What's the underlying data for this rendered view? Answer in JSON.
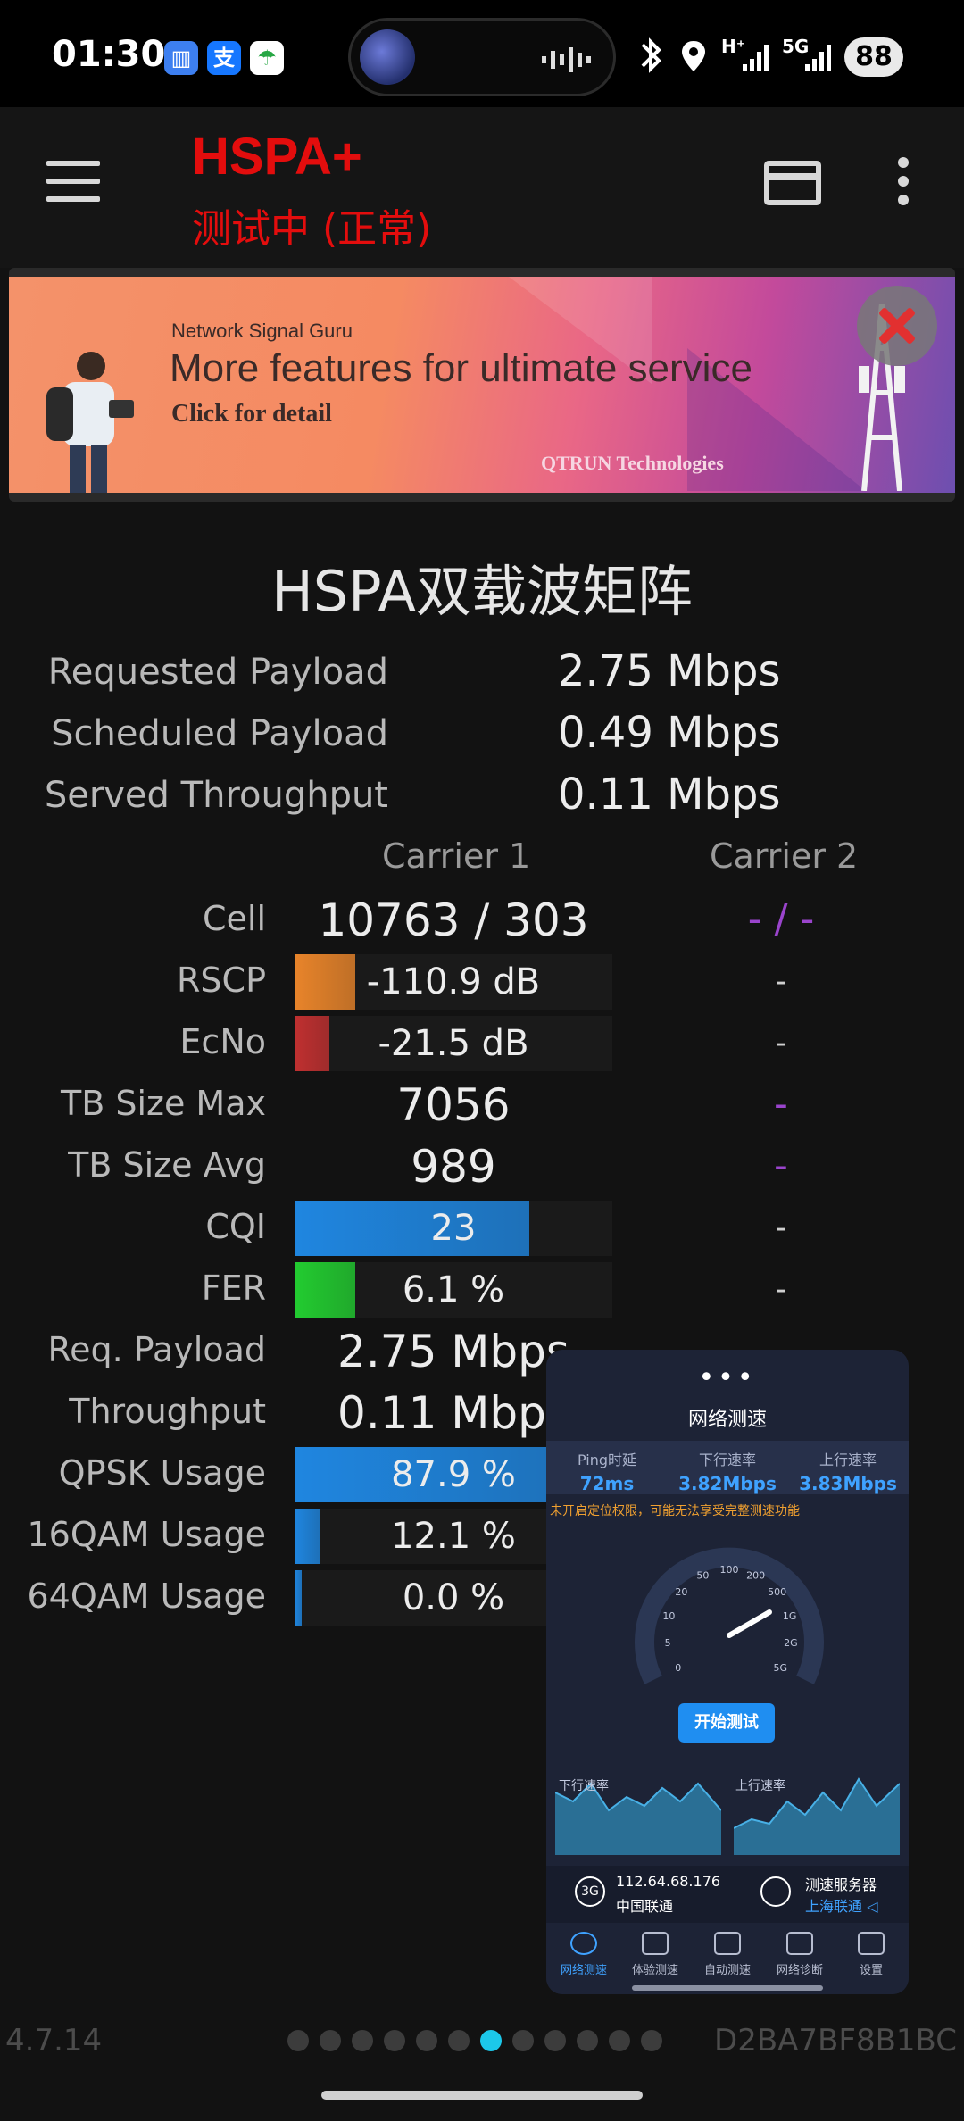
{
  "status_bar": {
    "time": "01:30",
    "network_1": "H⁺",
    "network_2": "5G",
    "battery": "88",
    "icons": [
      "signal-app-icon",
      "alipay-icon",
      "umbrella-app-icon",
      "bluetooth-icon",
      "location-icon",
      "signal-bars-icon"
    ]
  },
  "app_bar": {
    "title": "HSPA+",
    "subtitle": "测试中 (正常)",
    "title_color": "#e30d0d"
  },
  "ad": {
    "brand": "Network Signal Guru",
    "headline": "More features for ultimate service",
    "cta": "Click for detail",
    "company": "QTRUN Technologies"
  },
  "matrix": {
    "title": "HSPA双载波矩阵",
    "summary": [
      {
        "label": "Requested Payload",
        "value": "2.75 Mbps"
      },
      {
        "label": "Scheduled Payload",
        "value": "0.49 Mbps"
      },
      {
        "label": "Served Throughput",
        "value": "0.11 Mbps"
      }
    ],
    "carrier_1": "Carrier 1",
    "carrier_2": "Carrier 2",
    "rows": [
      {
        "label": "Cell",
        "c1": "10763 / 303",
        "c2": "- / -",
        "fill": null,
        "color": null
      },
      {
        "label": "RSCP",
        "c1": "-110.9 dB",
        "c2": "-",
        "fill": 0.19,
        "color": "#e8842a"
      },
      {
        "label": "EcNo",
        "c1": "-21.5 dB",
        "c2": "-",
        "fill": 0.11,
        "color": "#c03030"
      },
      {
        "label": "TB Size Max",
        "c1": "7056",
        "c2": "-",
        "fill": null,
        "color": null
      },
      {
        "label": "TB Size Avg",
        "c1": "989",
        "c2": "-",
        "fill": null,
        "color": null
      },
      {
        "label": "CQI",
        "c1": "23",
        "c2": "-",
        "fill": 0.74,
        "color": "#1f86e0"
      },
      {
        "label": "FER",
        "c1": "6.1 %",
        "c2": "-",
        "fill": 0.19,
        "color": "#22cc30"
      },
      {
        "label": "Req. Payload",
        "c1": "2.75 Mbps",
        "c2": "",
        "fill": null,
        "color": null
      },
      {
        "label": "Throughput",
        "c1": "0.11 Mbps",
        "c2": "",
        "fill": null,
        "color": null
      },
      {
        "label": "QPSK Usage",
        "c1": "87.9 %",
        "c2": "",
        "fill": 0.879,
        "color": "#1f86e0"
      },
      {
        "label": "16QAM Usage",
        "c1": "12.1 %",
        "c2": "",
        "fill": 0.08,
        "color": "#1f86e0"
      },
      {
        "label": "64QAM Usage",
        "c1": "0.0 %",
        "c2": "",
        "fill": 0.0,
        "color": "#1f86e0"
      }
    ]
  },
  "speed_test": {
    "title": "网络测速",
    "ping_label": "Ping时延",
    "ping_value": "72ms",
    "down_label": "下行速率",
    "down_value": "3.82Mbps",
    "up_label": "上行速率",
    "up_value": "3.83Mbps",
    "warning": "未开启定位权限，可能无法享受完整测速功能",
    "gauge_ticks": [
      "0",
      "5",
      "10",
      "20",
      "50",
      "100",
      "200",
      "500",
      "1G",
      "2G",
      "5G"
    ],
    "start_button": "开始测试",
    "graph_down_label": "下行速率",
    "graph_up_label": "上行速率",
    "network_badge": "3G",
    "ip": "112.64.68.176",
    "isp": "中国联通",
    "server_label": "测速服务器",
    "server_value": "上海联通 ◁",
    "nav": [
      "网络测速",
      "体验测速",
      "自动测速",
      "网络诊断",
      "设置"
    ]
  },
  "footer": {
    "version": "4.7.14",
    "device_id": "D2BA7BF8B1BC",
    "pages": 12,
    "active_page": 7
  }
}
